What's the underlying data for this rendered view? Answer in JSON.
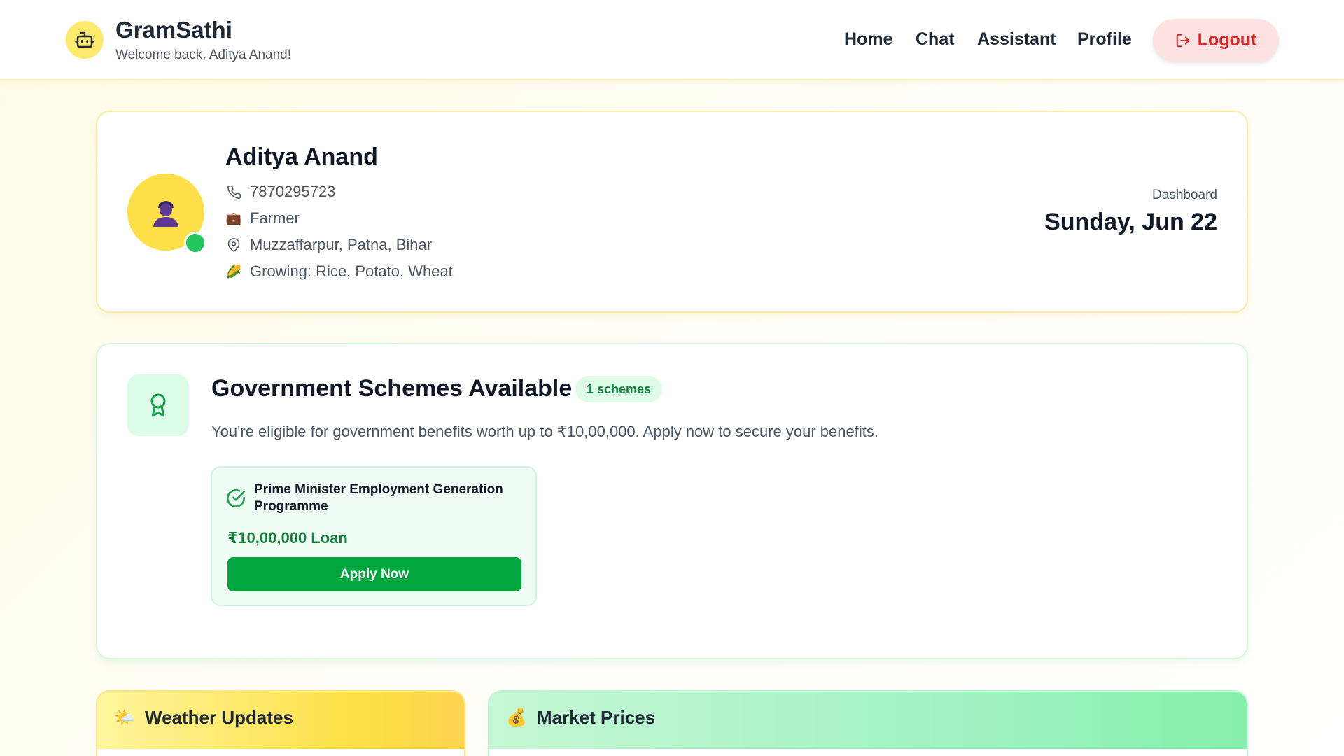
{
  "header": {
    "brand_title": "GramSathi",
    "brand_subtitle": "Welcome back, Aditya Anand!",
    "logo_icon": "bot-icon",
    "nav": [
      {
        "label": "Home"
      },
      {
        "label": "Chat"
      },
      {
        "label": "Assistant"
      },
      {
        "label": "Profile"
      }
    ],
    "logout_label": "Logout",
    "logout_icon": "logout-icon"
  },
  "profile": {
    "name": "Aditya Anand",
    "phone": "7870295723",
    "occupation": "Farmer",
    "location": "Muzzaffarpur, Patna, Bihar",
    "crops": "Growing: Rice, Potato, Wheat",
    "status": "online",
    "dashboard_label": "Dashboard",
    "date": "Sunday, Jun 22"
  },
  "schemes": {
    "title": "Government Schemes Available",
    "badge": "1 schemes",
    "description": "You're eligible for government benefits worth up to ₹10,00,000. Apply now to secure your benefits.",
    "items": [
      {
        "name": "Prime Minister Employment Generation Programme",
        "amount": "₹10,00,000 Loan",
        "action": "Apply Now"
      }
    ]
  },
  "weather": {
    "title": "Weather Updates",
    "icon": "🌤️"
  },
  "market": {
    "title": "Market Prices",
    "icon": "💰"
  },
  "colors": {
    "brand_yellow": "#fde047",
    "accent_green": "#00a63e",
    "logout_red": "#dc2626"
  }
}
